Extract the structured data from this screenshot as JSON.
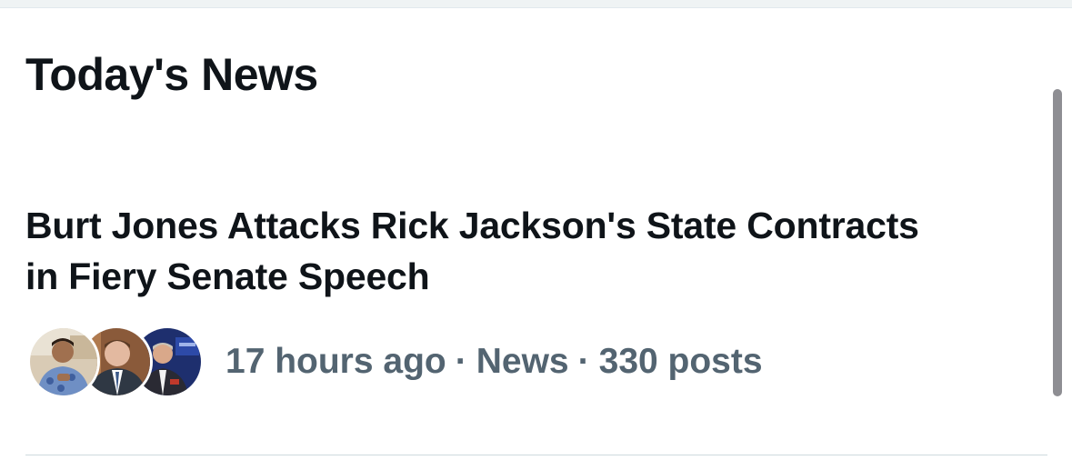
{
  "section": {
    "title": "Today's News"
  },
  "news_item": {
    "headline": "Burt Jones Attacks Rick Jackson's State Contracts in Fiery Senate Speech",
    "time": "17 hours ago",
    "separator": "·",
    "category": "News",
    "posts": "330 posts",
    "avatars": [
      {
        "icon": "person-photo-avatar"
      },
      {
        "icon": "person-photo-avatar"
      },
      {
        "icon": "person-photo-avatar"
      }
    ]
  },
  "colors": {
    "text_primary": "#0f1419",
    "text_secondary": "#536471",
    "divider": "#cfd9de",
    "scrollbar": "#8e8e93"
  }
}
